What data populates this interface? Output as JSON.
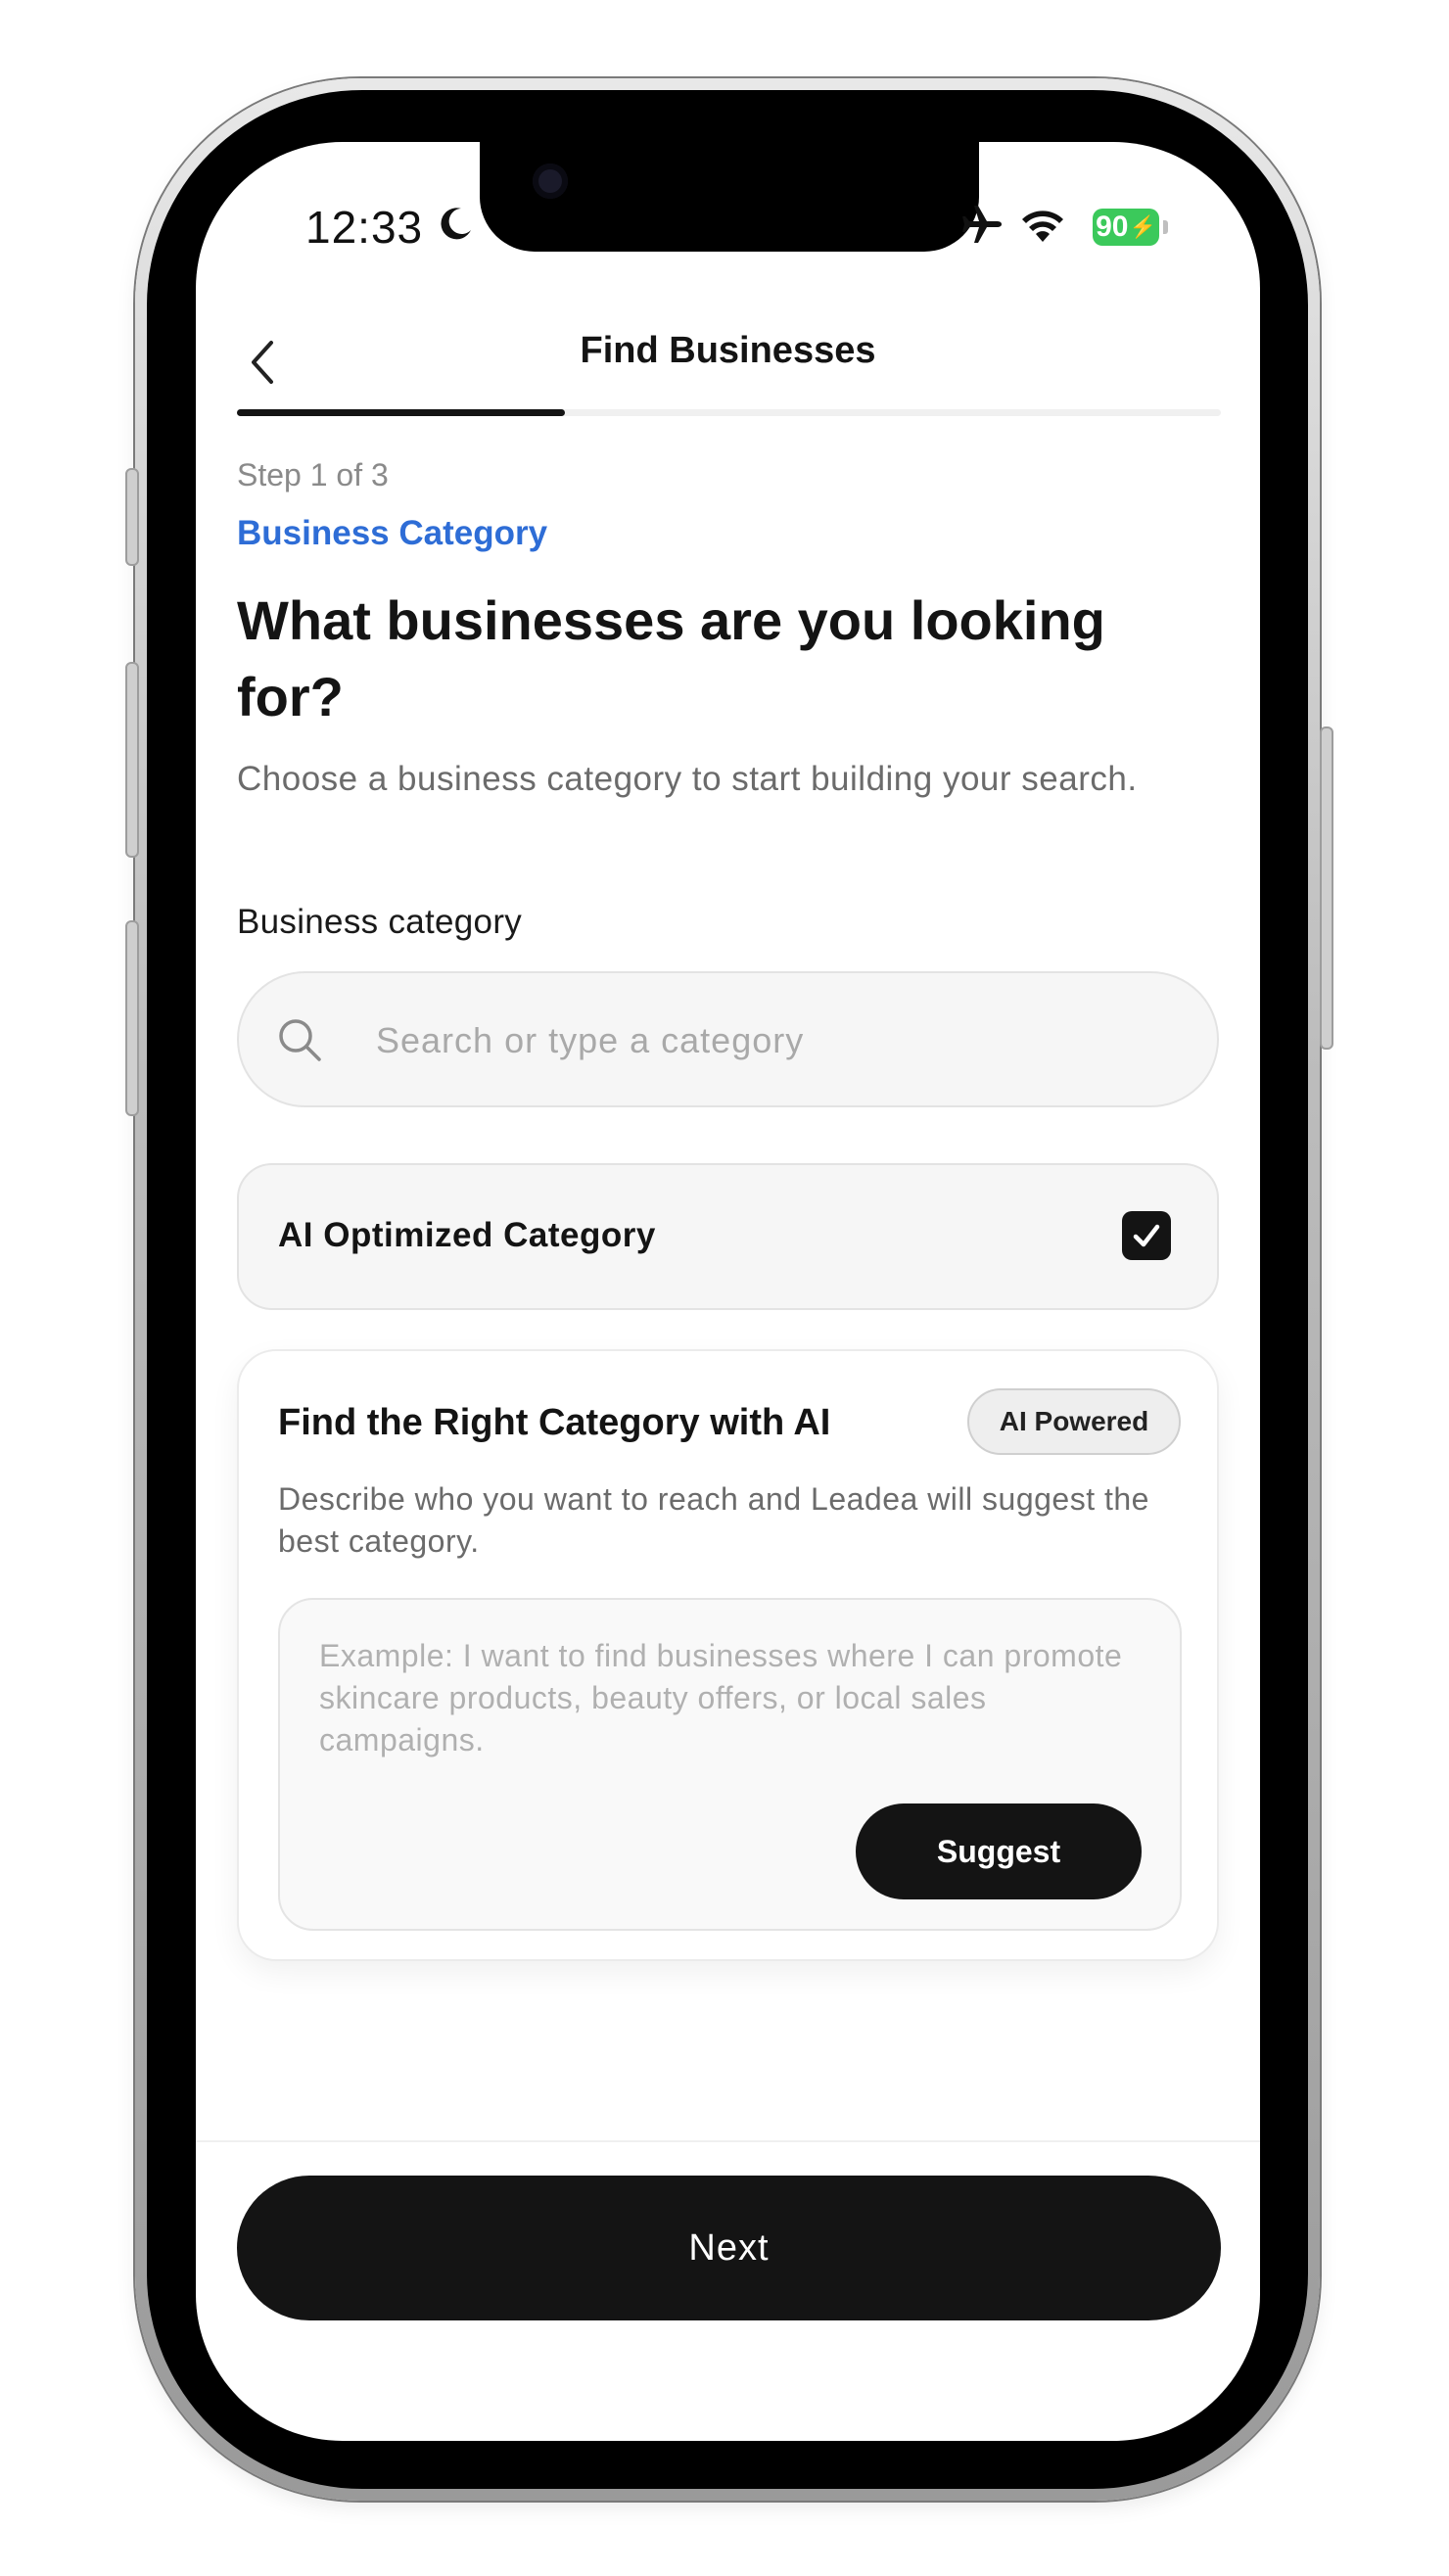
{
  "status_bar": {
    "time": "12:33",
    "battery": "90"
  },
  "header": {
    "title": "Find Businesses",
    "progress": 0.333
  },
  "step": {
    "indicator": "Step 1 of 3",
    "name": "Business Category"
  },
  "content": {
    "question": "What businesses are you looking for?",
    "subtitle": "Choose a business category to start building your search.",
    "field_label": "Business category"
  },
  "search": {
    "placeholder": "Search or type a category",
    "value": ""
  },
  "ai_optimized": {
    "label": "AI Optimized Category",
    "checked": true
  },
  "ai_card": {
    "title": "Find the Right Category with AI",
    "badge": "AI Powered",
    "description": "Describe who you want to reach and Leadea will suggest the best category.",
    "placeholder": "Example: I want to find businesses where I can promote skincare products, beauty offers, or local sales campaigns.",
    "suggest_label": "Suggest"
  },
  "footer": {
    "next_label": "Next"
  },
  "colors": {
    "accent": "#2e6dd6",
    "primary_button": "#141414",
    "battery": "#3bc95b"
  },
  "icons": [
    "back-chevron-icon",
    "moon-icon",
    "airplane-icon",
    "wifi-icon",
    "battery-icon",
    "search-icon",
    "checkmark-icon"
  ]
}
